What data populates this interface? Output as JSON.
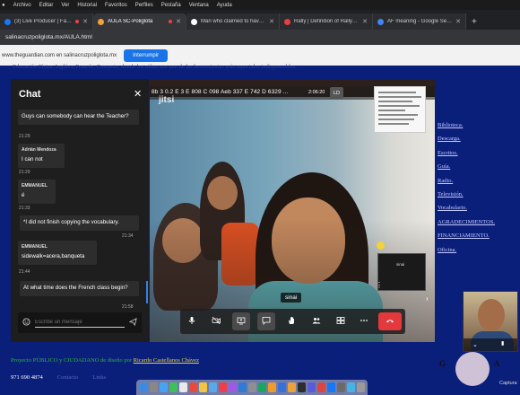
{
  "menubar": {
    "items": [
      "Archivo",
      "Editar",
      "Ver",
      "Historial",
      "Favoritos",
      "Perfiles",
      "Pestaña",
      "Ventana",
      "Ayuda"
    ]
  },
  "tabs": [
    {
      "title": "(3) Live Producer | Faceb...",
      "favicon_color": "#1877f2",
      "recording": true
    },
    {
      "title": "AULA SC-Poliglota",
      "favicon_color": "#f2a33a",
      "recording": true,
      "active": true
    },
    {
      "title": "Man who claimed to have...",
      "favicon_color": "#ffffff",
      "recording": false
    },
    {
      "title": "Rally | Definition of Rally by M...",
      "favicon_color": "#e34040",
      "recording": false
    },
    {
      "title": "AF meaning - Google Search",
      "favicon_color": "#4285f4",
      "recording": false
    }
  ],
  "address": {
    "url": "salinacruzpoliglota.mx/AULA.html"
  },
  "notification": {
    "text": "www.theguardian.com en salinacruzpoliglota.mx",
    "button": "Interrumpir"
  },
  "page": {
    "top_text": "Educación Física, Inglés o Francés, Computo, donde los niños son uno de las herramientas más especiales indispensables.",
    "sidebar_links": [
      "Biblioteca.",
      "Descarga.",
      "Escritos.",
      "Guía.",
      "Radio.",
      "Televisión.",
      "Vocabulario.",
      "AGRADECIMIENTOS.",
      "FINANCIAMIENTO.",
      "Oficina."
    ],
    "credit_prefix": "Proyecto PÚBLICO y CIUDADANO de diseño por",
    "credit_author": "Ricardo Castellanos Chávez",
    "phone": "971 690 4874",
    "contact": "Contacto",
    "links": "Links"
  },
  "chat": {
    "title": "Chat",
    "messages": [
      {
        "sender": "",
        "text": "Guys can somebody can hear the Teacher?",
        "time": "21:29"
      },
      {
        "sender": "Adrián Mendoza",
        "text": "I can not",
        "time": "21:29"
      },
      {
        "sender": "EMMANUEL",
        "text": "é",
        "time": "21:33"
      },
      {
        "sender": "",
        "text": "*I did not finish copying the vocabulary.",
        "time": "21:34"
      },
      {
        "sender": "EMMANUEL",
        "text": "sidewalk=acera,banqueta",
        "time": "21:44"
      },
      {
        "sender": "",
        "text": "At what time does the French class begin?",
        "time": "21:58"
      }
    ],
    "input_placeholder": "Escribe un mensaje"
  },
  "meeting": {
    "code": "8b 3 0.2 E 3 E 808 C 098 Aeb 337 E 742 D 6329 ...",
    "time": "2:06:20",
    "badge": "LD",
    "logo": "jitsi",
    "thumbnail_name": "sinai",
    "speaker_name": "sinai"
  },
  "decor": {
    "letters": "G",
    "letter_a": "A",
    "capture": "Captura"
  }
}
